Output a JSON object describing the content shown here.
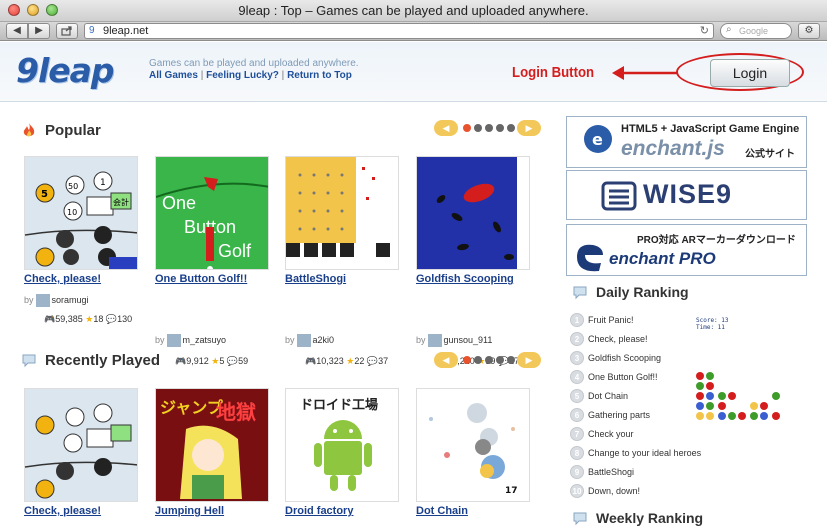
{
  "window": {
    "title": "9leap : Top – Games can be played and uploaded anywhere."
  },
  "toolbar": {
    "back": "◀",
    "forward": "▶",
    "url": "9leap.net",
    "search_placeholder": "Google"
  },
  "header": {
    "logo": "9leap",
    "tagline": "Games can be played and uploaded anywhere.",
    "links": [
      "All Games",
      "Feeling Lucky?",
      "Return to Top"
    ],
    "annotation": "Login Button",
    "login_label": "Login",
    "colors": {
      "annotation": "#d41d1d",
      "link": "#1f4f9a"
    }
  },
  "popular": {
    "title": "Popular",
    "games": [
      {
        "title": "Check, please!",
        "by": "by",
        "author": "soramugi",
        "plays": "59,385",
        "stars": "18",
        "comments": "130"
      },
      {
        "title": "One Button Golf!!",
        "by": "by",
        "author": "m_zatsuyo",
        "plays": "9,912",
        "stars": "5",
        "comments": "59"
      },
      {
        "title": "BattleShogi",
        "by": "by",
        "author": "a2ki0",
        "plays": "10,323",
        "stars": "22",
        "comments": "37"
      },
      {
        "title": "Goldfish Scooping",
        "by": "by",
        "author": "gunsou_911",
        "plays": "48,220",
        "stars": "39",
        "comments": "278"
      }
    ]
  },
  "recent": {
    "title": "Recently Played",
    "games": [
      {
        "title": "Check, please!"
      },
      {
        "title": "Jumping Hell"
      },
      {
        "title": "Droid factory"
      },
      {
        "title": "Dot Chain"
      }
    ]
  },
  "thumbs": {
    "golf_text": [
      "One",
      "Button",
      "Golf"
    ],
    "hell_text": [
      "ジャンプ",
      "地獄"
    ],
    "droid_text": "ドロイド工場",
    "check_stamp": "会計"
  },
  "sidebar": {
    "banner1": {
      "line1": "HTML5 + JavaScript Game Engine",
      "line2": "enchant.js",
      "line3": "公式サイト"
    },
    "banner2": {
      "text": "WISE9"
    },
    "banner3": {
      "line1": "PRO対応 ARマーカーダウンロード",
      "line2": "enchant PRO"
    },
    "daily_title": "Daily Ranking",
    "ranking": [
      {
        "n": "1",
        "label": "Fruit Panic!"
      },
      {
        "n": "2",
        "label": "Check, please!"
      },
      {
        "n": "3",
        "label": "Goldfish Scooping"
      },
      {
        "n": "4",
        "label": "One Button Golf!!"
      },
      {
        "n": "5",
        "label": "Dot Chain"
      },
      {
        "n": "6",
        "label": "Gathering parts"
      },
      {
        "n": "7",
        "label": "Check your"
      },
      {
        "n": "8",
        "label": "Change to your ideal heroes"
      },
      {
        "n": "9",
        "label": "BattleShogi"
      },
      {
        "n": "10",
        "label": "Down, down!"
      }
    ],
    "weekly_title": "Weekly Ranking"
  }
}
